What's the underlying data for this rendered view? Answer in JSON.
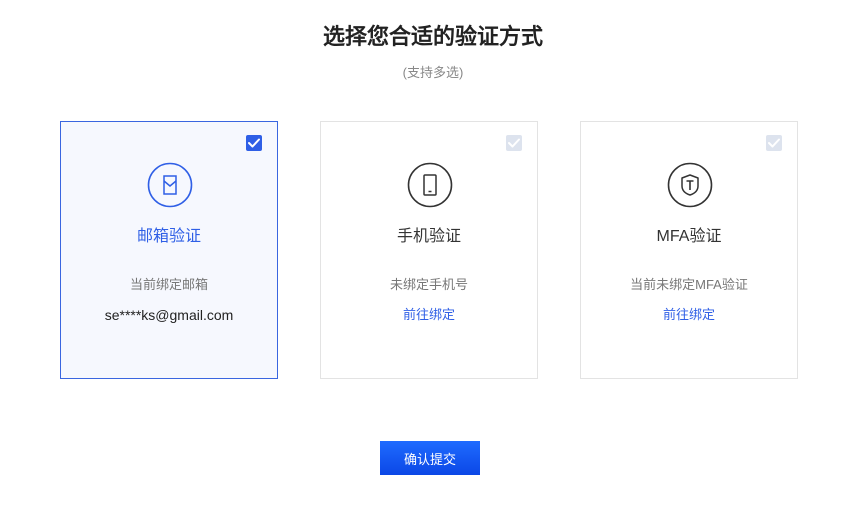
{
  "header": {
    "title": "选择您合适的验证方式",
    "subtitle": "(支持多选)"
  },
  "cards": [
    {
      "title": "邮箱验证",
      "icon": "email-icon",
      "selected": true,
      "desc": "当前绑定邮箱",
      "value": "se****ks@gmail.com"
    },
    {
      "title": "手机验证",
      "icon": "phone-icon",
      "selected": false,
      "desc": "未绑定手机号",
      "link": "前往绑定"
    },
    {
      "title": "MFA验证",
      "icon": "mfa-shield-icon",
      "selected": false,
      "desc": "当前未绑定MFA验证",
      "link": "前往绑定"
    }
  ],
  "actions": {
    "submit_label": "确认提交"
  },
  "colors": {
    "accent": "#2f5fe6",
    "selected_border": "#3a66e0",
    "selected_bg": "#f6f8fe",
    "card_border": "#e3e3e3",
    "checkbox_unchecked": "#dde3ee"
  }
}
